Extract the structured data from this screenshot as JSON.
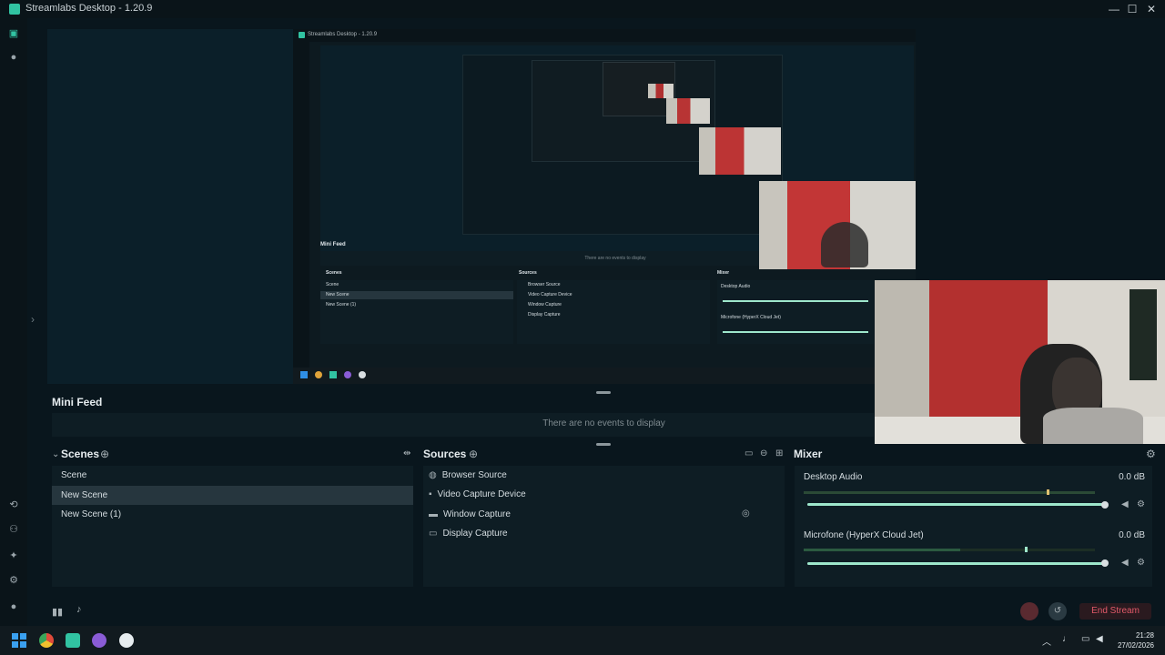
{
  "window": {
    "title": "Streamlabs Desktop - 1.20.9",
    "minimize": "—",
    "maximize": "☐",
    "close": "✕"
  },
  "nested_title": "Streamlabs Desktop - 1.20.9",
  "mini_feed": {
    "title": "Mini Feed",
    "empty_text": "There are no events to display"
  },
  "scenes": {
    "title": "Scenes",
    "items": [
      "Scene",
      "New Scene",
      "New Scene (1)"
    ],
    "selected_index": 1
  },
  "sources": {
    "title": "Sources",
    "items": [
      "Browser Source",
      "Video Capture Device",
      "Window Capture",
      "Display Capture"
    ]
  },
  "mixer": {
    "title": "Mixer",
    "channels": [
      {
        "name": "Desktop Audio",
        "level": "0.0 dB",
        "volume": 1.0
      },
      {
        "name": "Microfone (HyperX Cloud Jet)",
        "level": "0.0 dB",
        "volume": 1.0
      }
    ]
  },
  "footer": {
    "end_stream": "End Stream"
  },
  "taskbar": {
    "time": "21:28",
    "date": "27/02/2026"
  },
  "colors": {
    "accent": "#31c3a2",
    "end_stream": "#e45a6a",
    "background": "#09161d"
  }
}
